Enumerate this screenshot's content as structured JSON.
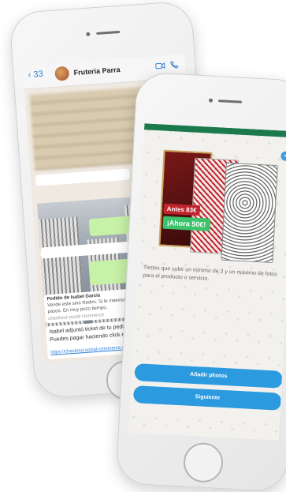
{
  "back_phone": {
    "back_label": "‹ 33",
    "contact_name": "Fruteria Parra",
    "video_icon": "video-icon",
    "call_icon": "phone-icon",
    "messages": [
      {
        "title": "Pedido de Isabel García",
        "body": "Vende este sino Redmi. Si le interesa añade el link y sigue los pasos. En muy poco tiempo.",
        "footer": "checkout social commerce"
      },
      {
        "title": "Isabel adjuntó ticket de tu pedido.",
        "body": "Puedes pagar haciendo click en el siguiente enlace:",
        "link": "https://checkout.social-commerce.com"
      }
    ]
  },
  "front_phone": {
    "badge_old_price": "Antes 83€",
    "badge_new_price": "¡Ahora 50€!",
    "description": "Tienes que subir un mínimo de 3 y un máximo de fotos para el producto o servicio.",
    "add_photos_label": "Añadir photos",
    "next_label": "Siguiente",
    "accent_color": "#2c9adf"
  }
}
